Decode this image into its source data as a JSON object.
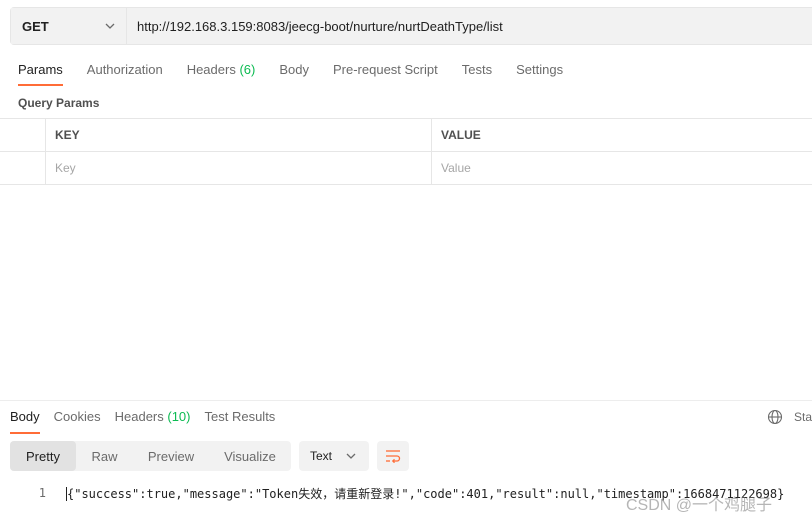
{
  "request": {
    "method": "GET",
    "url": "http://192.168.3.159:8083/jeecg-boot/nurture/nurtDeathType/list"
  },
  "request_tabs": [
    {
      "label": "Params",
      "count": "",
      "active": true
    },
    {
      "label": "Authorization",
      "count": "",
      "active": false
    },
    {
      "label": "Headers",
      "count": "(6)",
      "active": false
    },
    {
      "label": "Body",
      "count": "",
      "active": false
    },
    {
      "label": "Pre-request Script",
      "count": "",
      "active": false
    },
    {
      "label": "Tests",
      "count": "",
      "active": false
    },
    {
      "label": "Settings",
      "count": "",
      "active": false
    }
  ],
  "query_params": {
    "title": "Query Params",
    "key_header": "KEY",
    "value_header": "VALUE",
    "key_placeholder": "Key",
    "value_placeholder": "Value"
  },
  "response_tabs": [
    {
      "label": "Body",
      "count": "",
      "active": true
    },
    {
      "label": "Cookies",
      "count": "",
      "active": false
    },
    {
      "label": "Headers",
      "count": "(10)",
      "active": false
    },
    {
      "label": "Test Results",
      "count": "",
      "active": false
    }
  ],
  "response_status_text": "Sta",
  "format_buttons": [
    {
      "label": "Pretty",
      "active": true
    },
    {
      "label": "Raw",
      "active": false
    },
    {
      "label": "Preview",
      "active": false
    },
    {
      "label": "Visualize",
      "active": false
    }
  ],
  "format_type": "Text",
  "body_lines": [
    {
      "no": "1",
      "text": "{\"success\":true,\"message\":\"Token失效，请重新登录!\",\"code\":401,\"result\":null,\"timestamp\":1668471122698}"
    }
  ],
  "watermark": "CSDN @一个鸡腿子",
  "colors": {
    "accent": "#ff6c37",
    "count_green": "#0cbb52"
  },
  "icons": [
    "chevron-down-icon",
    "globe-icon",
    "wrap-lines-icon"
  ]
}
